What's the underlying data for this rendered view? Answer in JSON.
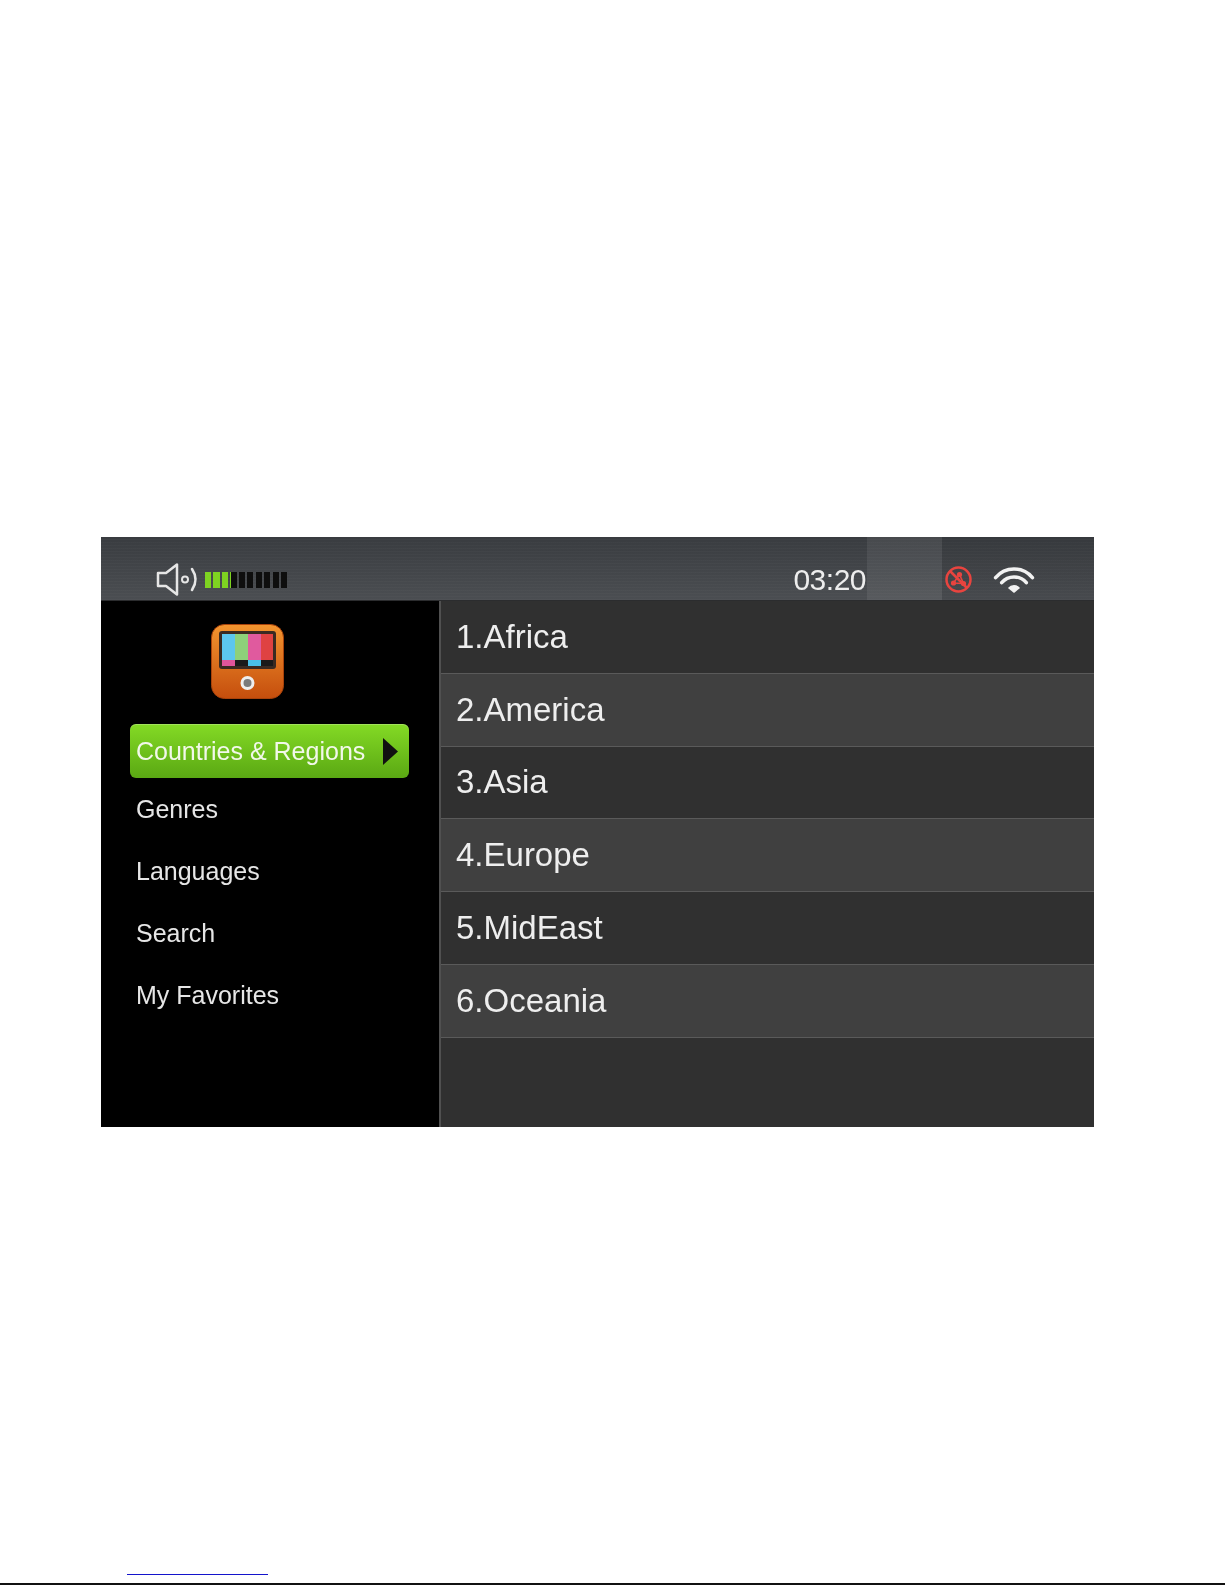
{
  "status_bar": {
    "volume": {
      "level": 0.3
    },
    "time": "03:20"
  },
  "sidebar": {
    "items": [
      {
        "label": "Countries & Regions",
        "selected": true
      },
      {
        "label": "Genres",
        "selected": false
      },
      {
        "label": "Languages",
        "selected": false
      },
      {
        "label": "Search",
        "selected": false
      },
      {
        "label": "My Favorites",
        "selected": false
      }
    ]
  },
  "list": {
    "items": [
      {
        "label": "1.Africa"
      },
      {
        "label": "2.America"
      },
      {
        "label": "3.Asia"
      },
      {
        "label": "4.Europe"
      },
      {
        "label": "5.MidEast"
      },
      {
        "label": "6.Oceania"
      }
    ]
  }
}
